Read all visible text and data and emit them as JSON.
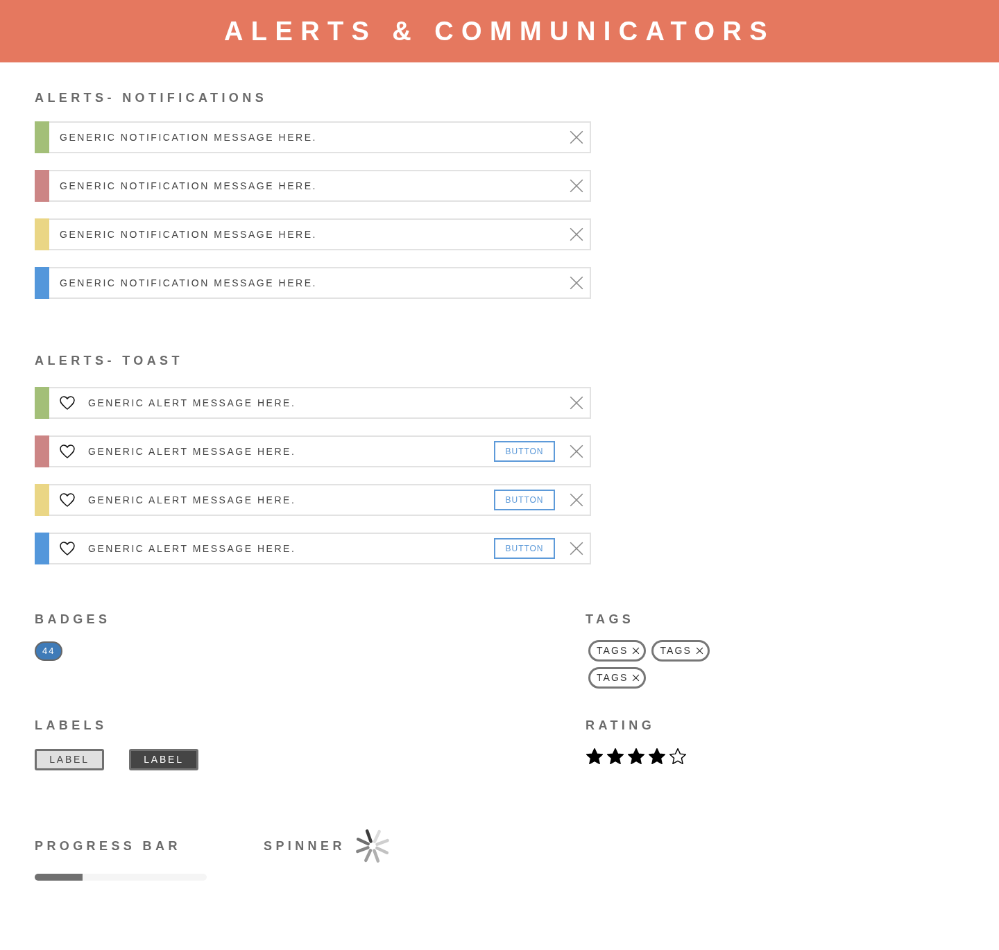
{
  "header": {
    "title": "ALERTS & COMMUNICATORS"
  },
  "notifications": {
    "title": "ALERTS- NOTIFICATIONS",
    "items": [
      {
        "message": "GENERIC NOTIFICATION MESSAGE HERE.",
        "color": "#a3bf78"
      },
      {
        "message": "GENERIC NOTIFICATION MESSAGE HERE.",
        "color": "#cc8585"
      },
      {
        "message": "GENERIC NOTIFICATION MESSAGE HERE.",
        "color": "#ead685"
      },
      {
        "message": "GENERIC NOTIFICATION MESSAGE HERE.",
        "color": "#5397db"
      }
    ]
  },
  "toasts": {
    "title": "ALERTS- TOAST",
    "items": [
      {
        "message": "GENERIC ALERT MESSAGE HERE.",
        "color": "#a3bf78"
      },
      {
        "message": "GENERIC ALERT MESSAGE HERE.",
        "color": "#cc8585",
        "button": "BUTTON"
      },
      {
        "message": "GENERIC ALERT MESSAGE HERE.",
        "color": "#ead685",
        "button": "BUTTON"
      },
      {
        "message": "GENERIC ALERT MESSAGE HERE.",
        "color": "#5397db",
        "button": "BUTTON"
      }
    ]
  },
  "badges": {
    "title": "BADGES",
    "items": [
      "44"
    ]
  },
  "tags": {
    "title": "TAGS",
    "items": [
      "TAGS",
      "TAGS",
      "TAGS"
    ]
  },
  "labels": {
    "title": "LABELS",
    "items": [
      {
        "text": "LABEL",
        "kind": "light"
      },
      {
        "text": "LABEL",
        "kind": "dark"
      }
    ]
  },
  "rating": {
    "title": "RATING",
    "stars": 4
  },
  "progress": {
    "title": "PROGRESS BAR",
    "level": 0.28
  },
  "spinner": {
    "title": "SPINNER"
  }
}
